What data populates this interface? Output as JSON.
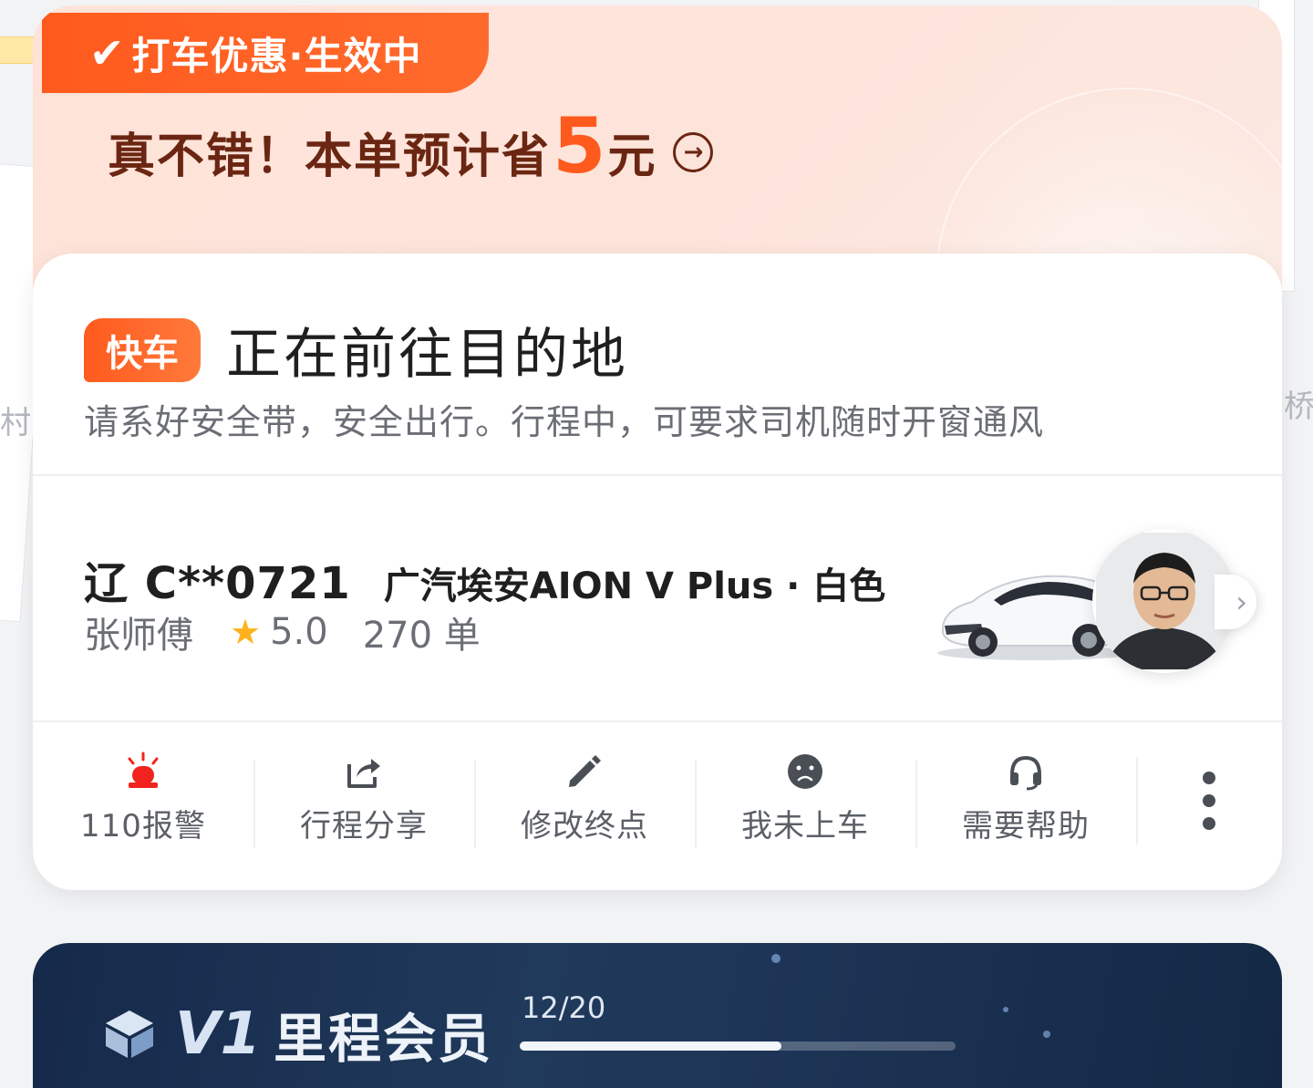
{
  "map": {
    "label_left": "村",
    "label_right": "桥"
  },
  "promo": {
    "tag": "打车优惠·生效中",
    "headline_prefix": "真不错！本单预计省",
    "amount": "5",
    "unit": "元"
  },
  "trip": {
    "car_type": "快车",
    "status": "正在前往目的地",
    "safety_tip": "请系好安全带，安全出行。行程中，可要求司机随时开窗通风"
  },
  "vehicle": {
    "plate": "辽 C**0721",
    "model": "广汽埃安AION V Plus · 白色",
    "driver_name": "张师傅",
    "rating": "5.0",
    "orders": "270 单"
  },
  "actions": [
    {
      "label": "110报警",
      "icon": "siren-icon"
    },
    {
      "label": "行程分享",
      "icon": "share-icon"
    },
    {
      "label": "修改终点",
      "icon": "pencil-icon"
    },
    {
      "label": "我未上车",
      "icon": "sad-face-icon"
    },
    {
      "label": "需要帮助",
      "icon": "headset-icon"
    }
  ],
  "member": {
    "level": "V1",
    "name": "里程会员",
    "progress_text": "12/20",
    "progress_current": 12,
    "progress_total": 20
  },
  "colors": {
    "accent": "#ff5a1e",
    "alarm": "#f0231e",
    "promo_text": "#6a2612",
    "member_bg": "#1b3152"
  }
}
